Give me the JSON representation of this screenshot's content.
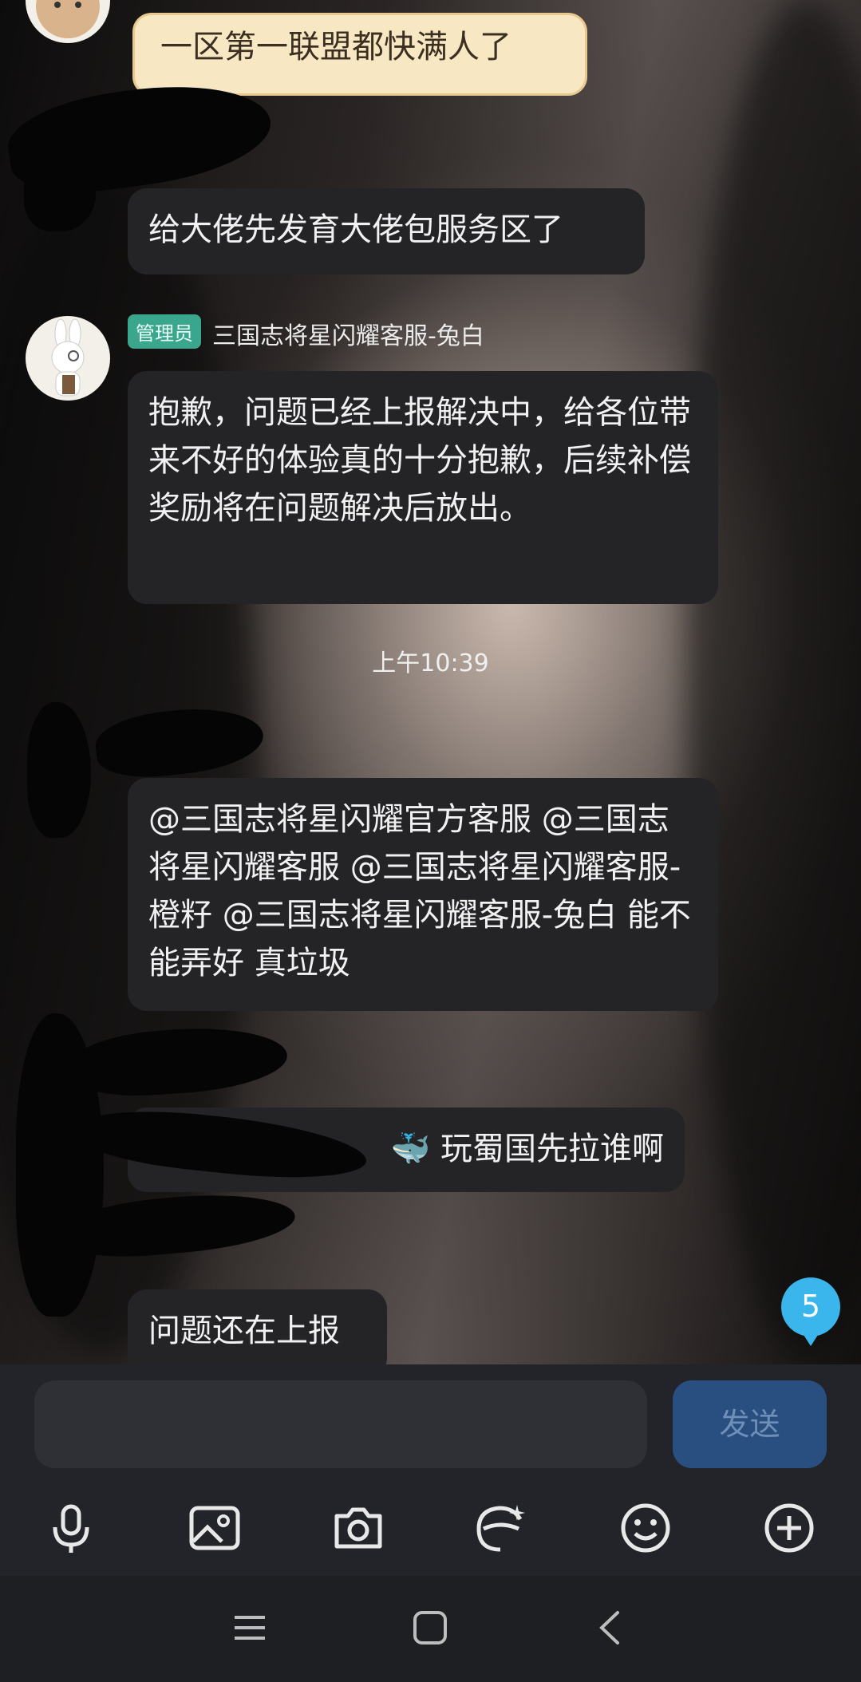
{
  "messages": [
    {
      "text": "一区第一联盟都快满人了"
    },
    {
      "text": "给大佬先发育大佬包服务区了"
    },
    {
      "badge": "管理员",
      "sender": "三国志将星闪耀客服-兔白",
      "text": "抱歉，问题已经上报解决中，给各位带来不好的体验真的十分抱歉，后续补偿奖励将在问题解决后放出。"
    },
    {
      "text": "@三国志将星闪耀官方客服 @三国志将星闪耀客服 @三国志将星闪耀客服-橙籽 @三国志将星闪耀客服-兔白 能不能弄好 真垃圾"
    },
    {
      "text": "玩蜀国先拉谁啊"
    },
    {
      "text": "问题还在上报"
    }
  ],
  "timestamp": "上午10:39",
  "unread_count": "5",
  "composer": {
    "placeholder": "",
    "send_label": "发送"
  },
  "toolbar_icons": [
    "microphone-icon",
    "image-icon",
    "camera-icon",
    "sticker-icon",
    "emoji-icon",
    "plus-icon"
  ],
  "colors": {
    "bubble": "#242427",
    "accent": "#3ab6ec",
    "send_button": "#284f80",
    "admin_badge": "#3aa78c"
  }
}
